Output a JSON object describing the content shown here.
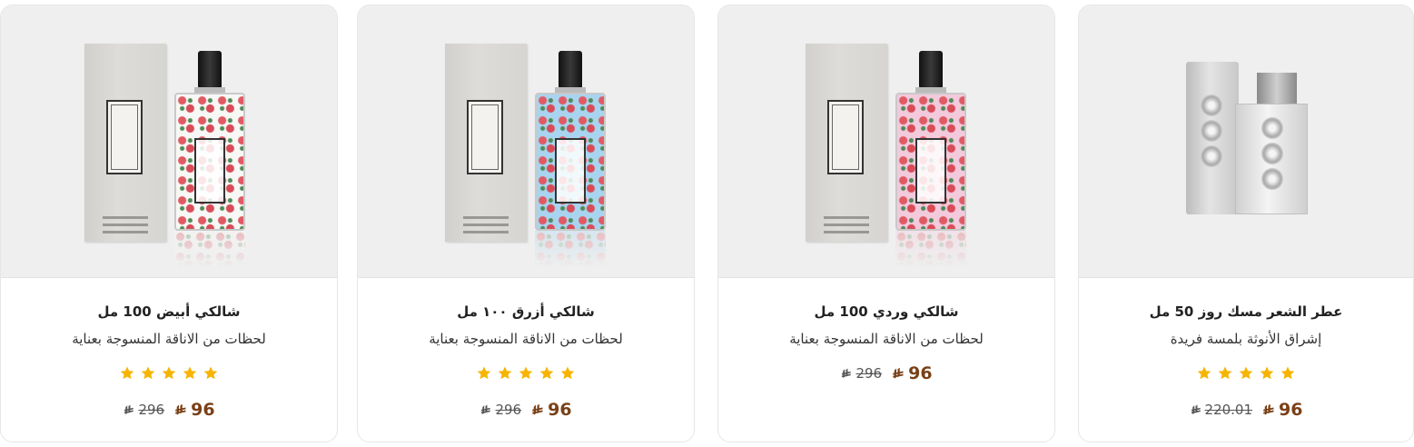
{
  "products": [
    {
      "title": "شالكي أبيض 100 مل",
      "subtitle": "لحظات من الاناقة المنسوجة بعناية",
      "rating": 5,
      "sale_price": "96",
      "old_price": "296",
      "variant": "white",
      "pattern_color": "#f7f7f5"
    },
    {
      "title": "شالكي أزرق ١٠٠ مل",
      "subtitle": "لحظات من الاناقة المنسوجة بعناية",
      "rating": 5,
      "sale_price": "96",
      "old_price": "296",
      "variant": "blue",
      "pattern_color": "#a9d4ef"
    },
    {
      "title": "شالكي وردي 100 مل",
      "subtitle": "لحظات من الاناقة المنسوجة بعناية",
      "rating": 0,
      "sale_price": "96",
      "old_price": "296",
      "variant": "pink",
      "pattern_color": "#f3c9dc"
    },
    {
      "title": "عطر الشعر مسك روز 50 مل",
      "subtitle": "إشراق الأنوثة بلمسة فريدة",
      "rating": 5,
      "sale_price": "96",
      "old_price": "220.01",
      "variant": "musk-rose"
    }
  ],
  "colors": {
    "star": "#f6b400",
    "sale_price": "#7a4118",
    "card_border": "#e6e6e6",
    "image_bg": "#efefef"
  },
  "icons": {
    "currency": "riyal-icon",
    "star": "star-icon"
  }
}
